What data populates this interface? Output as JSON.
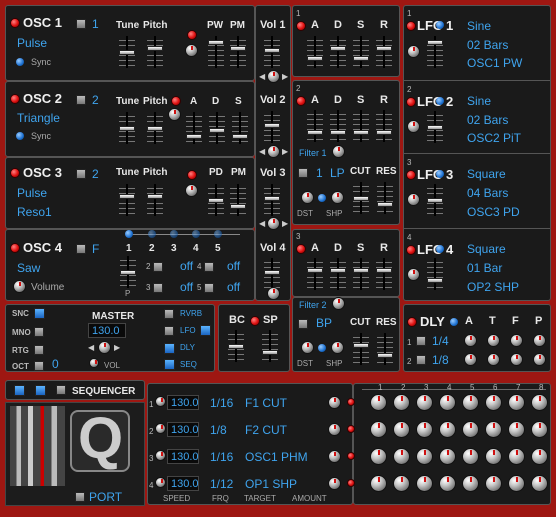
{
  "osc": [
    {
      "label": "OSC 1",
      "num": "1",
      "wave": "Pulse",
      "sync": "Sync",
      "cols": [
        "Tune",
        "Pitch",
        "PW",
        "PM"
      ]
    },
    {
      "label": "OSC 2",
      "num": "2",
      "wave": "Triangle",
      "sync": "Sync",
      "cols": [
        "Tune",
        "Pitch",
        "A",
        "D",
        "S"
      ]
    },
    {
      "label": "OSC 3",
      "num": "2",
      "wave": "Pulse",
      "wave2": "Reso1",
      "cols": [
        "Tune",
        "Pitch",
        "PD",
        "PM"
      ]
    },
    {
      "label": "OSC 4",
      "num": "F",
      "wave": "Saw",
      "mod": "Volume",
      "steps": [
        "1",
        "2",
        "3",
        "4",
        "5"
      ],
      "offs": [
        "2",
        "off",
        "4",
        "off",
        "3",
        "off",
        "5",
        "off"
      ],
      "p": "P"
    }
  ],
  "vol": [
    "Vol 1",
    "Vol 2",
    "Vol 3",
    "Vol 4"
  ],
  "env": [
    {
      "num": "1",
      "cols": [
        "A",
        "D",
        "S",
        "R"
      ]
    },
    {
      "num": "2",
      "cols": [
        "A",
        "D",
        "S",
        "R"
      ],
      "filter": "Filter 1",
      "fnum": "1",
      "mode": "LP",
      "cut": "CUT",
      "res": "RES",
      "dst": "DST",
      "shp": "SHP"
    },
    {
      "num": "3",
      "cols": [
        "A",
        "D",
        "S",
        "R"
      ]
    },
    {
      "num": "4",
      "cols": [
        "A",
        "D",
        "S",
        "R"
      ],
      "filter": "Filter 2",
      "mode": "BP",
      "cut": "CUT",
      "res": "RES",
      "dst": "DST",
      "shp": "SHP"
    }
  ],
  "lfo": [
    {
      "idx": "1",
      "label": "LFO",
      "num": "1",
      "shape": "Sine",
      "rate": "02 Bars",
      "target": "OSC1 PW"
    },
    {
      "idx": "2",
      "label": "LFO",
      "num": "2",
      "shape": "Sine",
      "rate": "02 Bars",
      "target": "OSC2 PiT"
    },
    {
      "idx": "3",
      "label": "LFO",
      "num": "3",
      "shape": "Square",
      "rate": "04 Bars",
      "target": "OSC3 PD"
    },
    {
      "idx": "4",
      "label": "LFO",
      "num": "4",
      "shape": "Square",
      "rate": "01 Bar",
      "target": "OP2 SHP"
    }
  ],
  "master": {
    "title": "MASTER",
    "bpm": "130.0",
    "snc": "SNC",
    "mno": "MNO",
    "rtg": "RTG",
    "oct": "OCT",
    "oct_val": "0",
    "vol": "VOL",
    "rvrb": "RVRB",
    "lfo": "LFO",
    "dly": "DLY",
    "seq": "SEQ"
  },
  "bcsp": {
    "bc": "BC",
    "sp": "SP"
  },
  "dly": {
    "label": "DLY",
    "cols": [
      "A",
      "T",
      "F",
      "P"
    ],
    "r1": "1",
    "v1": "1/4",
    "r2": "2",
    "v2": "1/8"
  },
  "seq": {
    "title": "SEQUENCER",
    "rows": [
      {
        "n": "1",
        "speed": "130.0",
        "frq": "1/16",
        "target": "F1 CUT"
      },
      {
        "n": "2",
        "speed": "130.0",
        "frq": "1/8",
        "target": "F2 CUT"
      },
      {
        "n": "3",
        "speed": "130.0",
        "frq": "1/16",
        "target": "OSC1 PHM"
      },
      {
        "n": "4",
        "speed": "130.0",
        "frq": "1/12",
        "target": "OP1 SHP"
      }
    ],
    "footer": [
      "SPEED",
      "FRQ",
      "TARGET",
      "AMOUNT"
    ],
    "steps": [
      "1",
      "2",
      "3",
      "4",
      "5",
      "6",
      "7",
      "8"
    ]
  },
  "logo": "Q",
  "port": "PORT"
}
